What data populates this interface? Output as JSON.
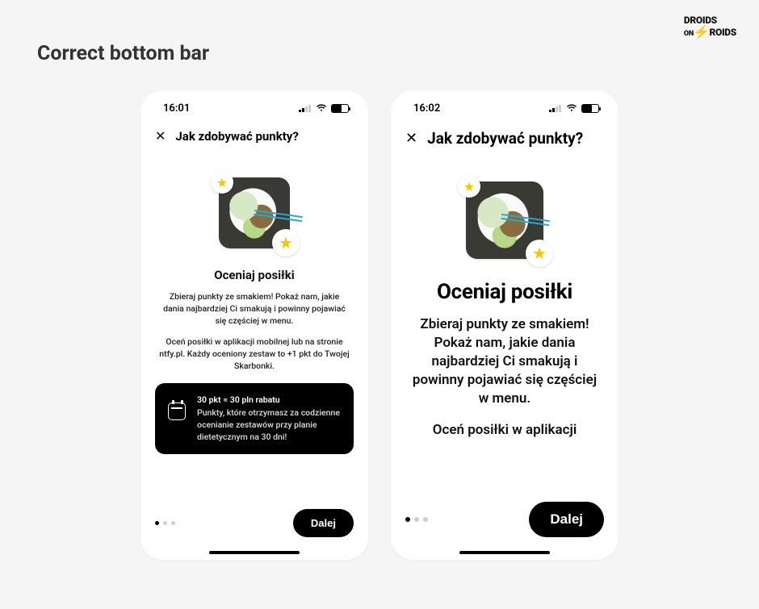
{
  "page_heading": "Correct bottom bar",
  "logo": {
    "line1": "DROIDS",
    "on": "ON",
    "line2": "ROIDS"
  },
  "phoneA": {
    "time": "16:01",
    "header": "Jak zdobywać punkty?",
    "title": "Oceniaj posiłki",
    "para1": "Zbieraj punkty ze smakiem! Pokaż nam, jakie dania najbardziej Ci smakują i powinny pojawiać się częściej w menu.",
    "para2": "Oceń posiłki w aplikacji mobilnej lub na stronie ntfy.pl. Każdy oceniony zestaw to +1 pkt do Twojej Skarbonki.",
    "box_line1": "30 pkt = 30 pln rabatu",
    "box_line2": "Punkty, które otrzymasz za codzienne ocenianie zestawów przy planie dietetycznym na 30 dni!",
    "next": "Dalej",
    "page_index": 0,
    "page_count": 3
  },
  "phoneB": {
    "time": "16:02",
    "header": "Jak zdobywać punkty?",
    "title": "Oceniaj posiłki",
    "para1": "Zbieraj punkty ze smakiem! Pokaż nam, jakie dania najbardziej Ci smakują i powinny pojawiać się częściej w menu.",
    "para2_visible": "Oceń posiłki w aplikacji",
    "next": "Dalej",
    "page_index": 0,
    "page_count": 3
  }
}
